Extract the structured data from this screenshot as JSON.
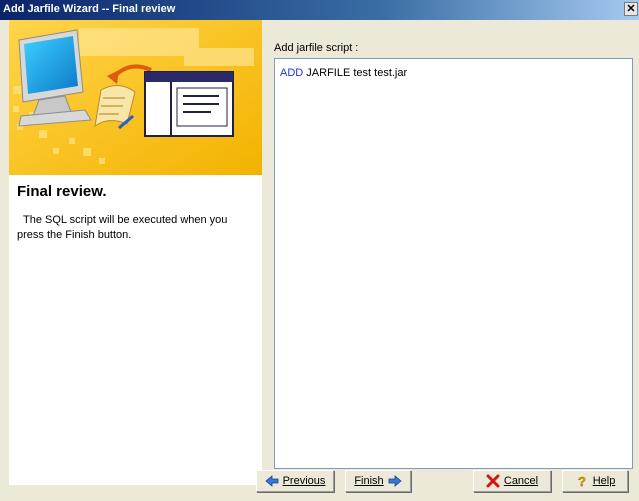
{
  "window": {
    "title": "Add Jarfile Wizard -- Final review",
    "close_glyph": "✕"
  },
  "left_panel": {
    "heading": "Final review.",
    "description_lines": [
      "The SQL script will be executed when you",
      "press the Finish button."
    ]
  },
  "main": {
    "script_label": "Add jarfile script :",
    "script": {
      "keyword": "ADD",
      "rest": " JARFILE test test.jar"
    }
  },
  "buttons": {
    "previous": {
      "label": "Previous",
      "icon": "arrow-left-icon"
    },
    "finish": {
      "label": "Finish",
      "icon": "arrow-right-icon"
    },
    "cancel": {
      "label": "Cancel",
      "icon": "red-x-icon"
    },
    "help": {
      "label": "Help",
      "icon": "question-mark-icon"
    }
  },
  "colors": {
    "keyword": "#1f34d4",
    "banner_yellow": "#f5c518",
    "titlebar": "#0a246a"
  }
}
